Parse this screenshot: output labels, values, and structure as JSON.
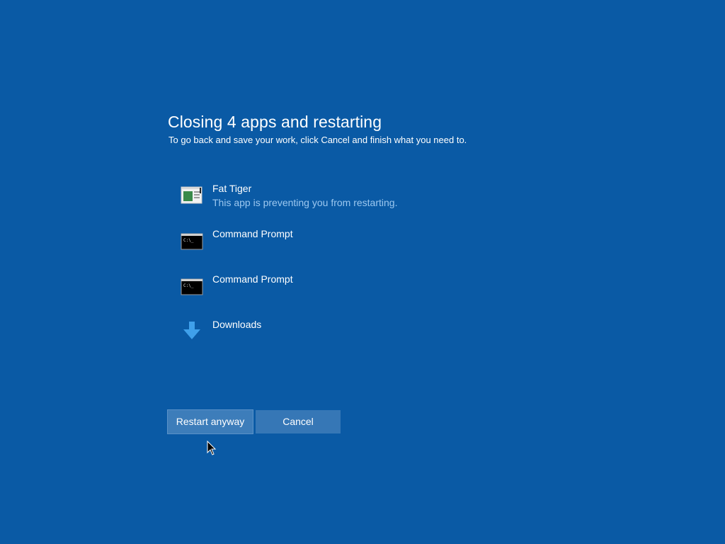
{
  "dialog": {
    "title": "Closing 4 apps and restarting",
    "subtitle": "To go back and save your work, click Cancel and finish what you need to."
  },
  "apps": [
    {
      "name": "Fat Tiger",
      "status": "This app is preventing you from restarting.",
      "icon": "fat-tiger-app-icon"
    },
    {
      "name": "Command Prompt",
      "status": "",
      "icon": "command-prompt-icon"
    },
    {
      "name": "Command Prompt",
      "status": "",
      "icon": "command-prompt-icon"
    },
    {
      "name": "Downloads",
      "status": "",
      "icon": "download-arrow-icon"
    }
  ],
  "buttons": {
    "restart_label": "Restart anyway",
    "cancel_label": "Cancel"
  },
  "colors": {
    "background": "#0a5aa5",
    "button": "#3677b6",
    "status_text": "#9cc8f0",
    "download_arrow": "#3fa0ea"
  }
}
